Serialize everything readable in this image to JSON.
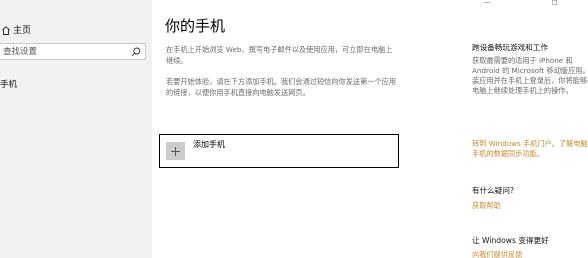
{
  "top_edge": {
    "left_fragment": "←",
    "right_fragment_1": "—",
    "right_fragment_2": "□"
  },
  "sidebar": {
    "home_label": "主页",
    "search_placeholder": "查找设置",
    "phone_label": "手机"
  },
  "main": {
    "title": "你的手机",
    "paragraph1": "在手机上开始浏览 Web、撰写电子邮件以及使用应用，可立即在电脑上继续。",
    "paragraph2": "若要开始体验，请在下方添加手机。我们会通过短信向你发送第一个应用的链接，以便你用手机直接向电脑发送网页。",
    "add_phone_label": "添加手机"
  },
  "right_panel": {
    "section1_heading": "跨设备畅玩游戏和工作",
    "section1_text": "获取最需要的适用于 iPhone 和 Android 的 Microsoft 移动版应用。安装应用并在手机上登录后，你将能够在电脑上继续处理手机上的操作。",
    "section1_link": "转到 Windows 手机门户。了解电脑和手机的数据同步功能。",
    "section2_heading": "有什么疑问?",
    "section2_link": "获取帮助",
    "section3_heading": "让 Windows 变得更好",
    "section3_link": "向我们提供反馈"
  },
  "colors": {
    "sidebar_bg": "#f2f2f2",
    "link": "#c98a2d",
    "muted_text": "#6b6b6b"
  }
}
